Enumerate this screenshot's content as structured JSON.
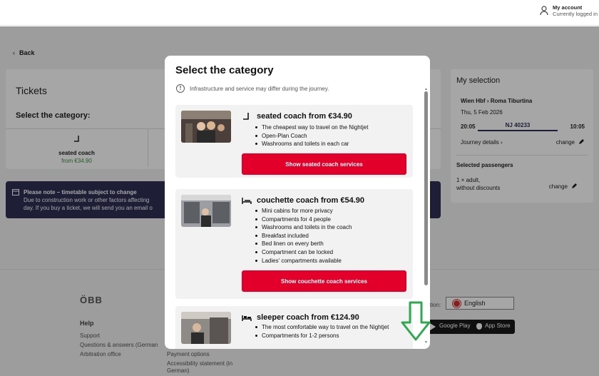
{
  "header": {
    "account_label": "My account",
    "account_status": "Currently logged in"
  },
  "page": {
    "back_label": "Back",
    "tickets_title": "Tickets",
    "select_category_label": "Select the category:",
    "tile_name": "seated coach",
    "tile_price": "from €34.90"
  },
  "notice": {
    "title": "Please note – timetable subject to change",
    "line1": "Due to construction work or other factors affecting",
    "line2": "day. If you buy a ticket, we will send you an email o"
  },
  "selection": {
    "title": "My selection",
    "route": "Wien Hbf › Roma Tiburtina",
    "date": "Thu, 5 Feb 2026",
    "departure": "20:05",
    "train": "NJ 40233",
    "arrival": "10:05",
    "details_label": "Journey details ›",
    "change_label": "change",
    "passengers_title": "Selected passengers",
    "passenger_line1": "1 × adult,",
    "passenger_line2": "without discounts"
  },
  "footer": {
    "logo": "ÖBB",
    "help_title": "Help",
    "links_col1": [
      "Support",
      "Questions & answers (German",
      "Arbitration office"
    ],
    "links_col2": [
      "Payment options",
      "Accessibility statement (in",
      "German)"
    ],
    "language_label": "tion:",
    "language_value": "English",
    "google_play": "Google Play",
    "app_store": "App Store"
  },
  "modal": {
    "title": "Select the category",
    "info_text": "Infrastructure and service may differ during the journey.",
    "cards": [
      {
        "title": "seated coach from €34.90",
        "features": [
          "The cheapest way to travel on the Nightjet",
          "Open-Plan Coach",
          "Washrooms and toilets in each car"
        ],
        "button": "Show seated coach services"
      },
      {
        "title": "couchette coach from €54.90",
        "features": [
          "Mini cabins for more privacy",
          "Compartments for 4 people",
          "Washrooms and toilets in the coach",
          "Breakfast included",
          "Bed linen on every berth",
          "Compartment can be locked",
          "Ladies' compartments available"
        ],
        "button": "Show couchette coach services"
      },
      {
        "title": "sleeper coach from €124.90",
        "features": [
          "The most comfortable way to travel on the Nightjet",
          "Compartments for 1-2 persons"
        ]
      }
    ]
  },
  "colors": {
    "accent_red": "#e2002a",
    "notice_navy": "#2f2f55",
    "arrow_green": "#2fa84f"
  }
}
